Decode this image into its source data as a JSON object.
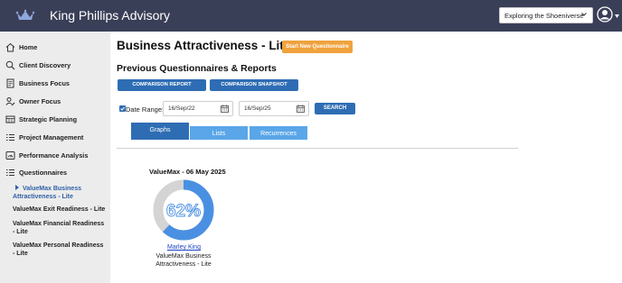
{
  "header": {
    "brand_name": "King Phillips Advisory",
    "shoe_select_value": "Exploring the Shoeniverse",
    "logo_icon": "crown-icon",
    "colors": {
      "topbar": "#3a3f58",
      "accent_orange": "#f0a23d",
      "accent_blue": "#2e6db4"
    }
  },
  "sidebar": {
    "items": [
      {
        "label": "Home",
        "icon": "home-icon"
      },
      {
        "label": "Client Discovery",
        "icon": "search-icon"
      },
      {
        "label": "Business Focus",
        "icon": "document-icon"
      },
      {
        "label": "Owner Focus",
        "icon": "user-edit-icon"
      },
      {
        "label": "Strategic Planning",
        "icon": "calendar-grid-icon"
      },
      {
        "label": "Project Management",
        "icon": "list-icon"
      },
      {
        "label": "Performance Analysis",
        "icon": "gauge-icon"
      },
      {
        "label": "Questionnaires",
        "icon": "list-icon"
      }
    ],
    "sub_items": [
      {
        "label": "ValueMax Business Attractiveness - Lite"
      },
      {
        "label": "ValueMax Exit Readiness - Lite"
      },
      {
        "label": "ValueMax Financial Readiness - Lite"
      },
      {
        "label": "ValueMax Personal Readiness - Lite"
      }
    ]
  },
  "main": {
    "title": "Business Attractiveness - Lite",
    "start_button": "Start New Questionnaire",
    "section_title": "Previous Questionnaires & Reports",
    "comparison_report": "COMPARISON REPORT",
    "comparison_snapshot": "COMPARISON SNAPSHOT",
    "date_range_label": "Date Range:",
    "date_range_checked": true,
    "date_from": "16/Sep/22",
    "date_to": "16/Sep/25",
    "search_button": "SEARCH",
    "tabs": [
      {
        "label": "Graphs",
        "active": true
      },
      {
        "label": "Lists",
        "active": false
      },
      {
        "label": "Recurrences",
        "active": false
      }
    ],
    "card": {
      "title": "ValueMax - 06 May 2025",
      "percent": 62,
      "percent_label": "62%",
      "person": "Marley King",
      "assessment": "ValueMax Business Attractiveness - Lite"
    }
  }
}
